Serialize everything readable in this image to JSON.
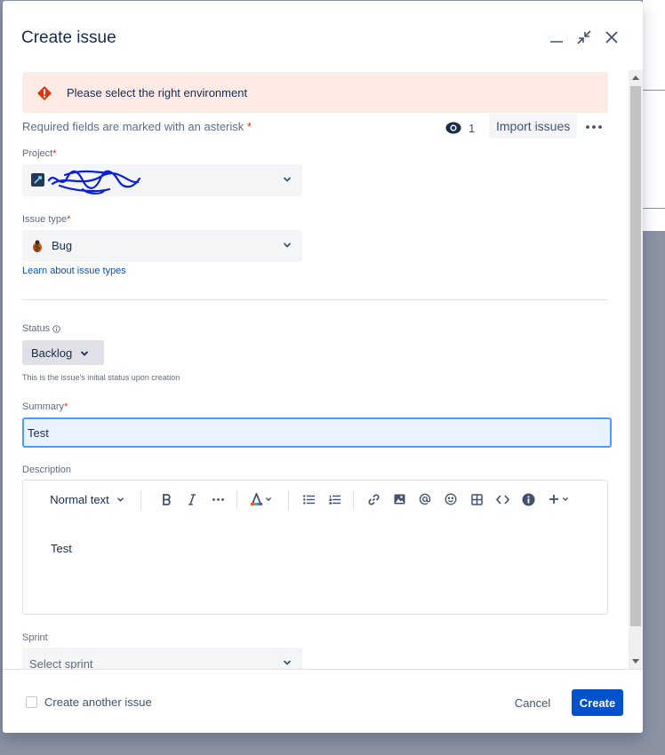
{
  "dialog": {
    "title": "Create issue"
  },
  "banner": {
    "message": "Please select the right environment"
  },
  "required_note": {
    "text": "Required fields are marked with an asterisk",
    "asterisk": "*"
  },
  "watchers": {
    "count": "1"
  },
  "import_button": {
    "label": "Import issues"
  },
  "project": {
    "label": "Project",
    "asterisk": "*"
  },
  "issue_type": {
    "label": "Issue type",
    "asterisk": "*",
    "value": "Bug",
    "link": "Learn about issue types"
  },
  "status": {
    "label": "Status",
    "value": "Backlog",
    "helper": "This is the issue's initial status upon creation"
  },
  "summary": {
    "label": "Summary",
    "asterisk": "*",
    "value": "Test"
  },
  "description": {
    "label": "Description",
    "text_style": "Normal text",
    "content": "Test"
  },
  "sprint": {
    "label": "Sprint",
    "placeholder": "Select sprint"
  },
  "footer": {
    "create_another_label": "Create another issue",
    "cancel_label": "Cancel",
    "create_label": "Create"
  },
  "colors": {
    "primary": "#0052cc",
    "error_banner": "#ffebe6",
    "error_icon": "#de350b",
    "focus_border": "#4c9aff"
  }
}
